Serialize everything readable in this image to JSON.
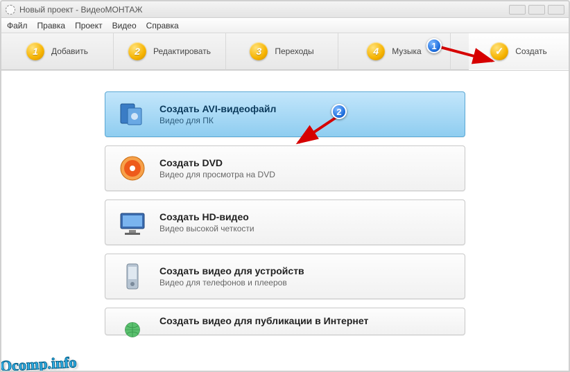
{
  "window": {
    "title": "Новый проект - ВидеоМОНТАЖ"
  },
  "menu": {
    "file": "Файл",
    "edit": "Правка",
    "project": "Проект",
    "video": "Видео",
    "help": "Справка"
  },
  "tabs": {
    "add": {
      "num": "1",
      "label": "Добавить"
    },
    "editTab": {
      "num": "2",
      "label": "Редактировать"
    },
    "trans": {
      "num": "3",
      "label": "Переходы"
    },
    "music": {
      "num": "4",
      "label": "Музыка"
    },
    "create": {
      "label": "Создать"
    }
  },
  "options": [
    {
      "title": "Создать AVI-видеофайл",
      "subtitle": "Видео для ПК",
      "iconColor": "#3a7cc5",
      "selected": true
    },
    {
      "title": "Создать DVD",
      "subtitle": "Видео для просмотра на DVD",
      "iconColor": "#ee7a1a"
    },
    {
      "title": "Создать HD-видео",
      "subtitle": "Видео высокой четкости",
      "iconColor": "#3b6cb0"
    },
    {
      "title": "Создать видео для устройств",
      "subtitle": "Видео для телефонов и плееров",
      "iconColor": "#8ea0b2"
    },
    {
      "title": "Создать видео для публикации в Интернет",
      "subtitle": "",
      "iconColor": "#3aa24b"
    }
  ],
  "annotations": {
    "c1": "1",
    "c2": "2"
  },
  "watermark": "Ocomp.info"
}
